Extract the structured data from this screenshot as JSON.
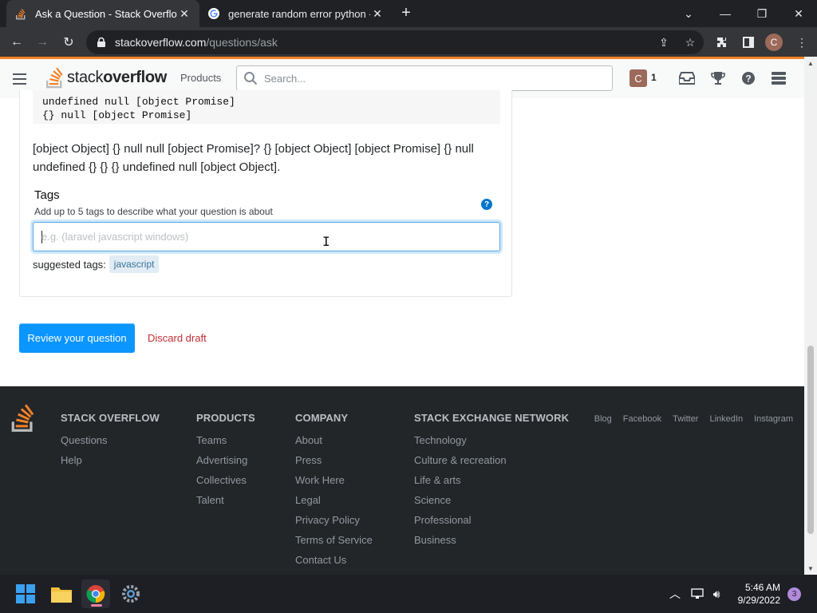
{
  "browser": {
    "tabs": [
      {
        "title": "Ask a Question - Stack Overflow",
        "icon": "stackoverflow-favicon",
        "active": true
      },
      {
        "title": "generate random error python -",
        "icon": "google-favicon",
        "active": false
      }
    ],
    "url_host": "stackoverflow.com",
    "url_path": "/questions/ask",
    "profile_initial": "C"
  },
  "topbar": {
    "logo_text_light": "stack",
    "logo_text_bold": "overflow",
    "products_label": "Products",
    "search_placeholder": "Search...",
    "user_initial": "C",
    "reputation": "1"
  },
  "question": {
    "code_lines": [
      "undefined null [object Promise]",
      "{} null [object Promise]"
    ],
    "body_text": "[object Object] {} null null [object Promise]? {} [object Object] [object Promise] {} null undefined {} {} {} undefined null [object Object]."
  },
  "tags": {
    "label": "Tags",
    "description": "Add up to 5 tags to describe what your question is about",
    "placeholder": "e.g. (laravel javascript windows)",
    "suggested_label": "suggested tags:",
    "suggested": [
      "javascript"
    ]
  },
  "actions": {
    "review_label": "Review your question",
    "discard_label": "Discard draft"
  },
  "footer": {
    "columns": [
      {
        "heading": "STACK OVERFLOW",
        "links": [
          "Questions",
          "Help"
        ]
      },
      {
        "heading": "PRODUCTS",
        "links": [
          "Teams",
          "Advertising",
          "Collectives",
          "Talent"
        ]
      },
      {
        "heading": "COMPANY",
        "links": [
          "About",
          "Press",
          "Work Here",
          "Legal",
          "Privacy Policy",
          "Terms of Service",
          "Contact Us"
        ]
      },
      {
        "heading": "STACK EXCHANGE NETWORK",
        "links": [
          "Technology",
          "Culture & recreation",
          "Life & arts",
          "Science",
          "Professional",
          "Business"
        ]
      }
    ],
    "social": [
      "Blog",
      "Facebook",
      "Twitter",
      "LinkedIn",
      "Instagram"
    ]
  },
  "taskbar": {
    "time": "5:46 AM",
    "date": "9/29/2022",
    "notification_count": "3"
  },
  "colors": {
    "so_orange": "#f48225",
    "primary_blue": "#0a95ff",
    "discard_red": "#c22e32"
  }
}
